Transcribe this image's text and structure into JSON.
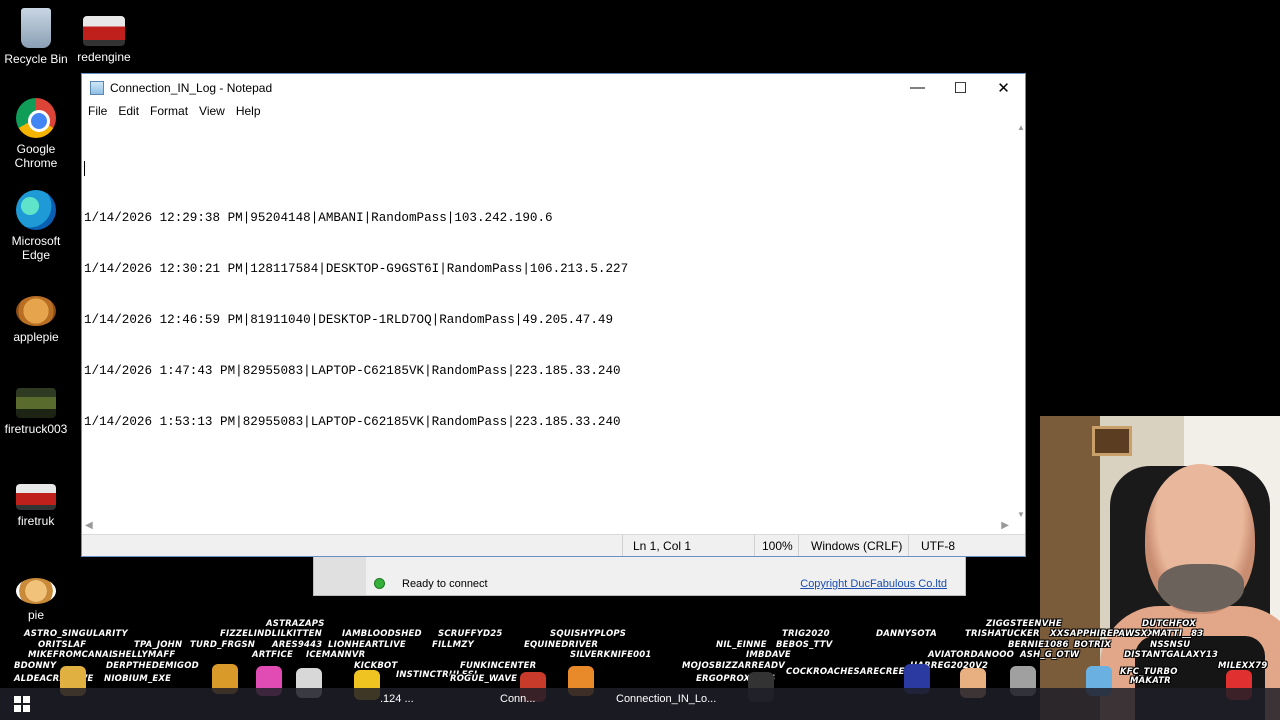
{
  "desktop": {
    "icons": [
      {
        "label": "Recycle Bin",
        "icon": "recycle-bin-icon"
      },
      {
        "label": "redengine",
        "icon": "red-truck-image-icon"
      },
      {
        "label": "Google Chrome",
        "icon": "chrome-icon"
      },
      {
        "label": "Microsoft Edge",
        "icon": "edge-icon"
      },
      {
        "label": "applepie",
        "icon": "apple-pie-image-icon"
      },
      {
        "label": "firetruck003",
        "icon": "firetruck-image-icon"
      },
      {
        "label": "firetruk",
        "icon": "firetruck-image-icon"
      },
      {
        "label": "pie",
        "icon": "pie-image-icon"
      }
    ]
  },
  "notepad": {
    "title": "Connection_IN_Log - Notepad",
    "menu": [
      "File",
      "Edit",
      "Format",
      "View",
      "Help"
    ],
    "lines": [
      "",
      "1/14/2026 12:29:38 PM|95204148|AMBANI|RandomPass|103.242.190.6",
      "1/14/2026 12:30:21 PM|128117584|DESKTOP-G9GST6I|RandomPass|106.213.5.227",
      "1/14/2026 12:46:59 PM|81911040|DESKTOP-1RLD7OQ|RandomPass|49.205.47.49",
      "1/14/2026 1:47:43 PM|82955083|LAPTOP-C62185VK|RandomPass|223.185.33.240",
      "1/14/2026 1:53:13 PM|82955083|LAPTOP-C62185VK|RandomPass|223.185.33.240"
    ],
    "status": {
      "position": "Ln 1, Col 1",
      "zoom": "100%",
      "line_ending": "Windows (CRLF)",
      "encoding": "UTF-8"
    }
  },
  "background_app": {
    "status_text": "Ready to connect",
    "status_color": "#35b03a",
    "copyright": "Copyright DucFabulous Co.ltd"
  },
  "overlay_names": [
    "ASTRAZAPS",
    "ZIGGSTEENVHE",
    "DUTCHFOX",
    "ASTRO_SINGULARITY",
    "FIZZELINDLILKITTEN",
    "IAMBLOODSHED",
    "SCRUFFYD25",
    "SQUISHYPLOPS",
    "TRIG2020",
    "DANNYSOTA",
    "TRISHATUCKER",
    "XXSAPPHIREPAWSXX",
    "MATTI__83",
    "ORITSLAF",
    "TPA_JOHN",
    "TURD_FRGSN",
    "ARES9443",
    "LIONHEARTLIVE",
    "FILLMZY",
    "EQUINEDRIVER",
    "NIL_EINNE",
    "BEBOS_TTV",
    "BERNIE1086",
    "BOTRIX",
    "NSSNSU",
    "MIKEFROMCANADA",
    "SHELLYMAFF",
    "ARTFICE",
    "ICEMANNVR",
    "SILVERKNIFE001",
    "IMBDAVE",
    "AVIATORDANOOO",
    "ASH_G_OTW",
    "DISTANTGALAXY13",
    "BDONNY",
    "DERPTHEDEMIGOD",
    "KICKBOT",
    "INSTINCTRULESI",
    "FUNKINCENTER",
    "MOJOSBIZZARREADV",
    "HARREG2020V2",
    "MILEXX79",
    "ALDEACREATIVE",
    "NIOBIUM_EXE",
    "ROGUE_WAVE",
    "ERGOPROXY666",
    "COCKROACHESARECREEPS",
    "KFC_TURBO",
    "MAKATR"
  ],
  "taskbar": {
    "items": [
      ".124 ...",
      "Conn...",
      "Connection_IN_Lo..."
    ]
  }
}
